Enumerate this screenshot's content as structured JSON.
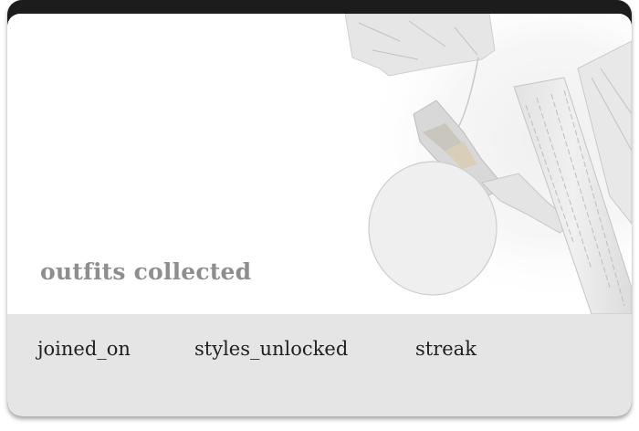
{
  "profile_card": {
    "title": "outfits collected",
    "stats": [
      {
        "label": "joined_on"
      },
      {
        "label": "styles_unlocked"
      },
      {
        "label": "streak"
      }
    ]
  },
  "colors": {
    "frame": "#1c1c1c",
    "hero_background": "#ffffff",
    "stats_background": "#e5e5e5",
    "title_text": "#8e8e8e",
    "stat_text": "#202020"
  },
  "icons": [
    "fashion-collage-decoration"
  ]
}
